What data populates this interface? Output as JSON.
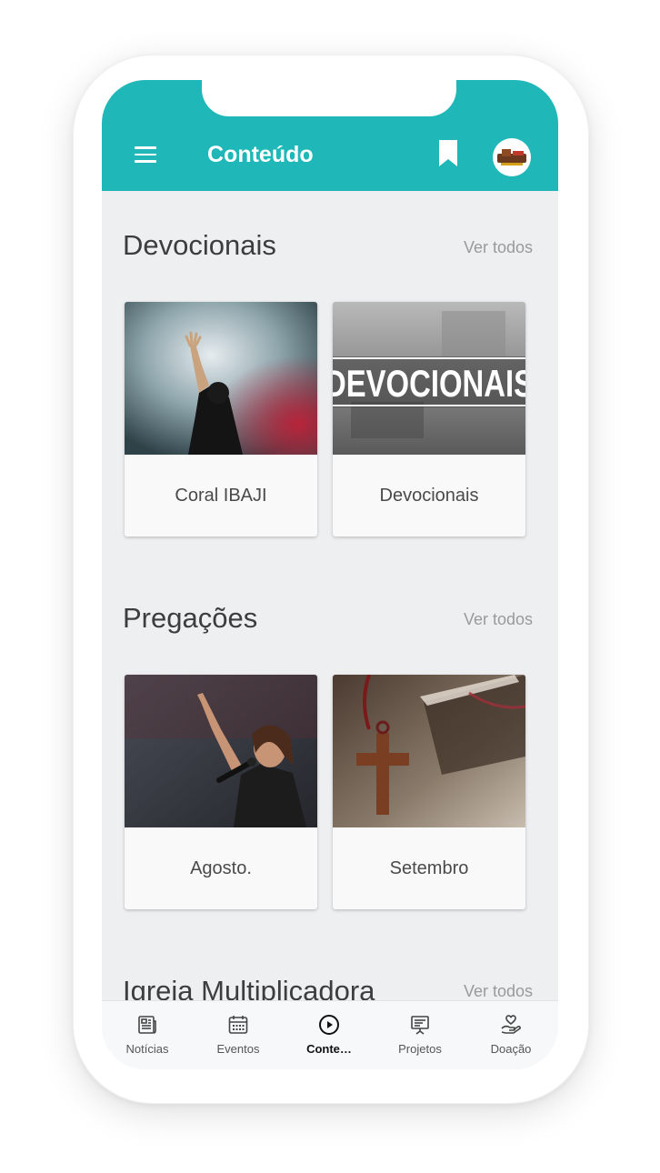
{
  "appbar": {
    "title": "Conteúdo"
  },
  "sections": [
    {
      "title": "Devocionais",
      "see_all": "Ver todos",
      "cards": [
        {
          "label": "Coral IBAJI"
        },
        {
          "label": "Devocionais",
          "banner_text": "DEVOCIONAIS"
        }
      ]
    },
    {
      "title": "Pregações",
      "see_all": "Ver todos",
      "cards": [
        {
          "label": "Agosto."
        },
        {
          "label": "Setembro"
        }
      ]
    },
    {
      "title": "Igreja Multiplicadora",
      "see_all": "Ver todos"
    }
  ],
  "bottom_nav": {
    "items": [
      {
        "label": "Notícias",
        "icon": "newspaper-icon"
      },
      {
        "label": "Eventos",
        "icon": "calendar-icon"
      },
      {
        "label": "Conte…",
        "icon": "play-circle-icon",
        "active": true
      },
      {
        "label": "Projetos",
        "icon": "presentation-icon"
      },
      {
        "label": "Doação",
        "icon": "heart-hand-icon"
      }
    ]
  },
  "colors": {
    "accent": "#1fb7b8",
    "background": "#eeeff1"
  }
}
